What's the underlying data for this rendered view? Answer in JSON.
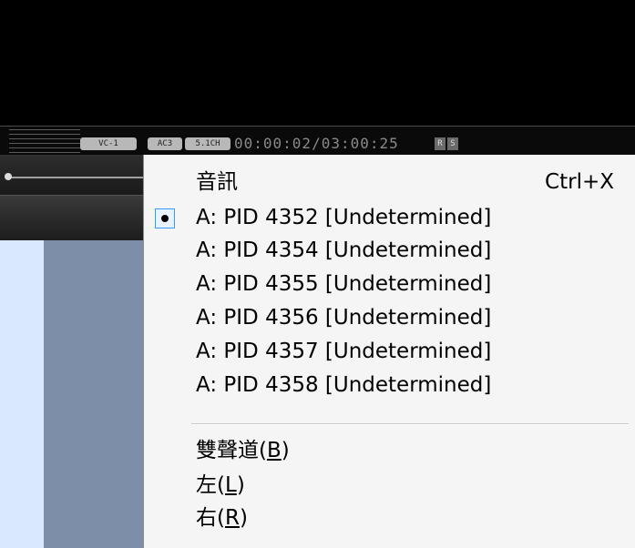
{
  "status_bar": {
    "video_codec": "VC-1",
    "audio_codec": "AC3",
    "channels": "5.1CH",
    "time": "00:00:02/03:00:25",
    "r_label": "R",
    "s_label": "S"
  },
  "menu": {
    "title": "音訊",
    "shortcut": "Ctrl+X",
    "tracks": [
      "A: PID 4352 [Undetermined]",
      "A: PID 4354 [Undetermined]",
      "A: PID 4355 [Undetermined]",
      "A: PID 4356 [Undetermined]",
      "A: PID 4357 [Undetermined]",
      "A: PID 4358 [Undetermined]"
    ],
    "selected_track_index": 0,
    "channel_modes": [
      {
        "text": "雙聲道(",
        "key": "B",
        "tail": ")"
      },
      {
        "text": "左(",
        "key": "L",
        "tail": ")"
      },
      {
        "text": "右(",
        "key": "R",
        "tail": ")"
      }
    ]
  }
}
